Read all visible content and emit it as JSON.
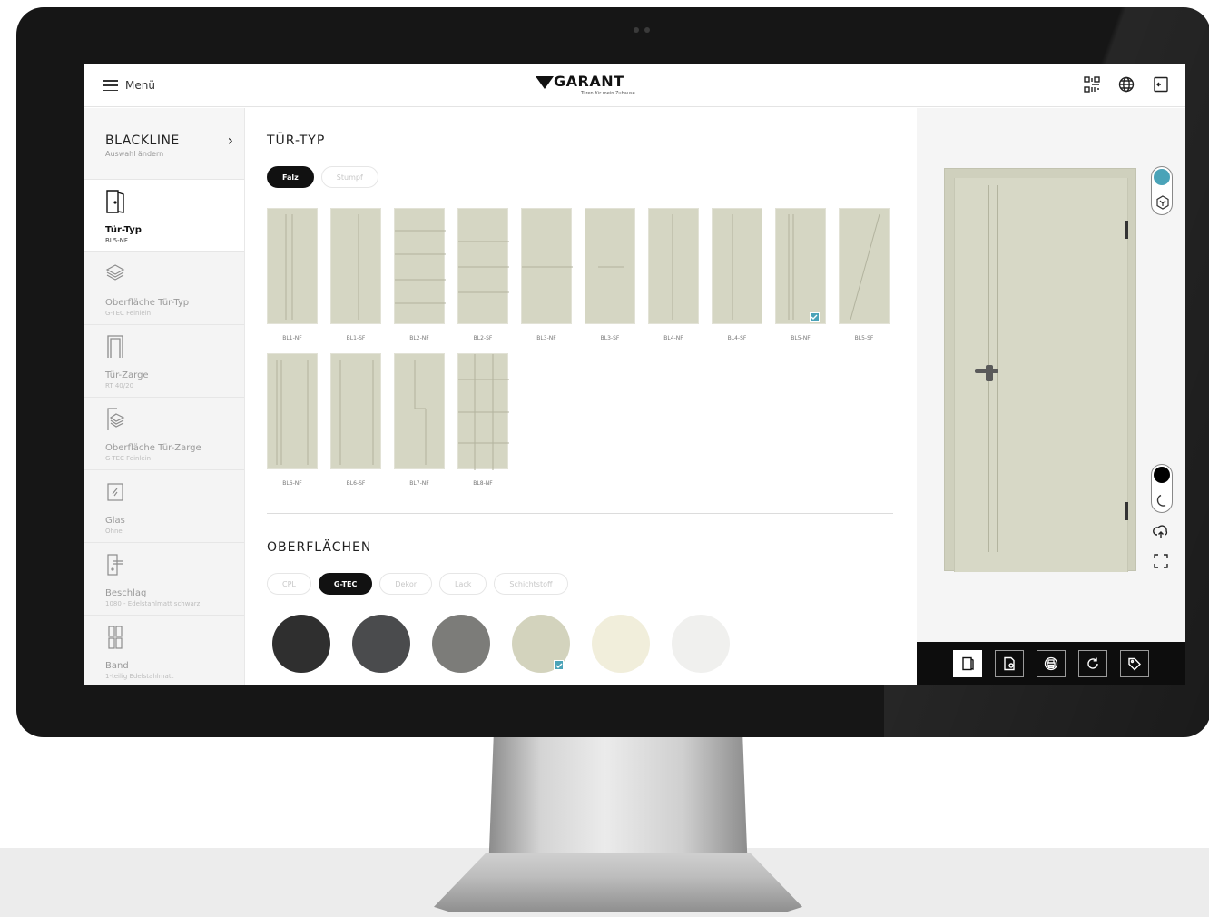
{
  "header": {
    "menu_label": "Menü",
    "logo_word": "GARANT",
    "logo_tagline": "Türen für mein Zuhause",
    "icons": [
      "qr-code-icon",
      "globe-icon",
      "exit-icon"
    ]
  },
  "sidebar": {
    "brand": {
      "title": "BLACKLINE",
      "subtitle": "Auswahl ändern"
    },
    "items": [
      {
        "title": "Tür-Typ",
        "sub": "BL5-NF",
        "icon": "door-icon",
        "active": true
      },
      {
        "title": "Oberfläche Tür-Typ",
        "sub": "G-TEC Feinlein",
        "icon": "layers-icon",
        "active": false
      },
      {
        "title": "Tür-Zarge",
        "sub": "RT 40/20",
        "icon": "frame-icon",
        "active": false
      },
      {
        "title": "Oberfläche Tür-Zarge",
        "sub": "G-TEC Feinlein",
        "icon": "frame-surface-icon",
        "active": false
      },
      {
        "title": "Glas",
        "sub": "Ohne",
        "icon": "glass-icon",
        "active": false
      },
      {
        "title": "Beschlag",
        "sub": "1080 - Edelstahlmatt schwarz",
        "icon": "fitting-icon",
        "active": false
      },
      {
        "title": "Band",
        "sub": "1-teilig Edelstahlmatt",
        "icon": "hinge-icon",
        "active": false
      }
    ]
  },
  "door_type": {
    "title": "TÜR-TYP",
    "tabs": [
      {
        "label": "Falz",
        "active": true
      },
      {
        "label": "Stumpf",
        "active": false
      }
    ],
    "doors": [
      {
        "label": "BL1-NF",
        "selected": false
      },
      {
        "label": "BL1-SF",
        "selected": false
      },
      {
        "label": "BL2-NF",
        "selected": false
      },
      {
        "label": "BL2-SF",
        "selected": false
      },
      {
        "label": "BL3-NF",
        "selected": false
      },
      {
        "label": "BL3-SF",
        "selected": false
      },
      {
        "label": "BL4-NF",
        "selected": false
      },
      {
        "label": "BL4-SF",
        "selected": false
      },
      {
        "label": "BL5-NF",
        "selected": true
      },
      {
        "label": "BL5-SF",
        "selected": false
      },
      {
        "label": "BL6-NF",
        "selected": false
      },
      {
        "label": "BL6-SF",
        "selected": false
      },
      {
        "label": "BL7-NF",
        "selected": false
      },
      {
        "label": "BL8-NF",
        "selected": false
      }
    ]
  },
  "surfaces": {
    "title": "OBERFLÄCHEN",
    "tabs": [
      {
        "label": "CPL",
        "active": false
      },
      {
        "label": "G-TEC",
        "active": true
      },
      {
        "label": "Dekor",
        "active": false
      },
      {
        "label": "Lack",
        "active": false
      },
      {
        "label": "Schichtstoff",
        "active": false
      }
    ],
    "swatches": [
      {
        "color": "#2f2f2f",
        "selected": false
      },
      {
        "color": "#4a4b4d",
        "selected": false
      },
      {
        "color": "#7c7c79",
        "selected": false
      },
      {
        "color": "#d3d3bd",
        "selected": true
      },
      {
        "color": "#f1eedb",
        "selected": false
      },
      {
        "color": "#f0f0ee",
        "selected": false
      }
    ]
  },
  "preview": {
    "door_color": "#d7d8c6",
    "accent": "#4aa3b8",
    "toolbar": [
      "door-view-icon",
      "door-detail-icon",
      "print-icon",
      "reset-icon",
      "tag-icon"
    ]
  }
}
